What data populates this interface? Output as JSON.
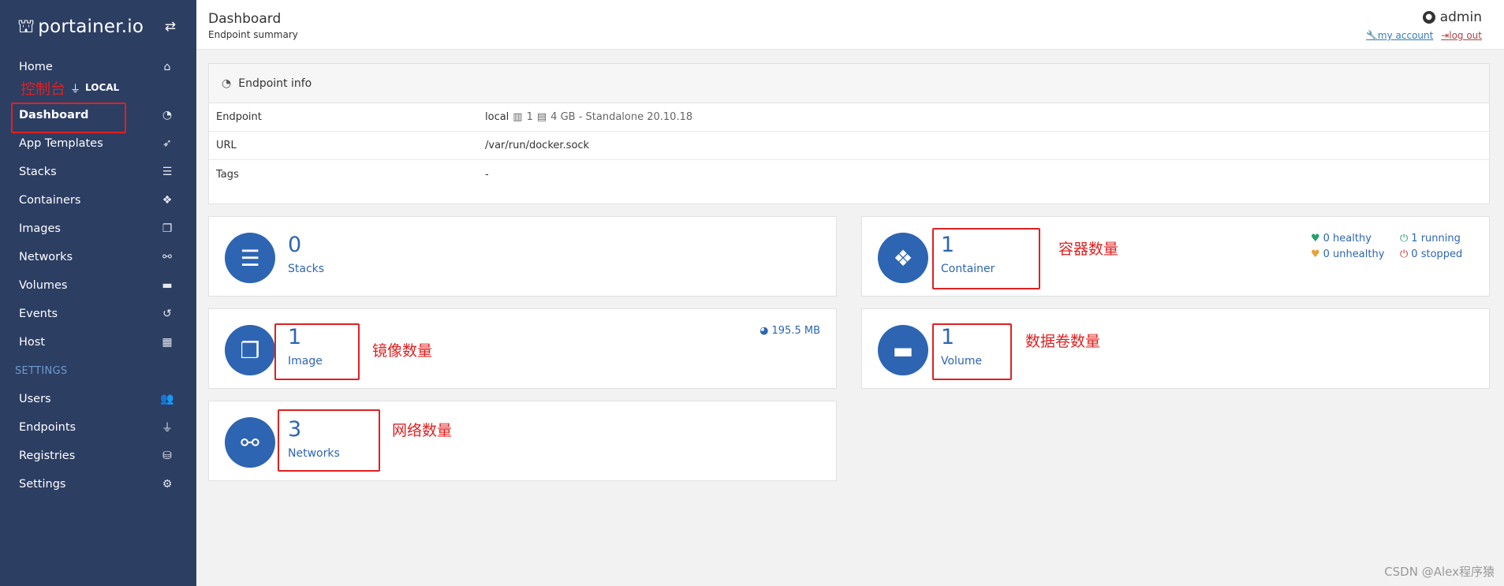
{
  "brand": {
    "name": "portainer.io"
  },
  "sidebar": {
    "home": "Home",
    "endpoint_annotation": "控制台",
    "endpoint_label": "LOCAL",
    "items": [
      {
        "label": "Dashboard",
        "icon": "tachometer-icon"
      },
      {
        "label": "App Templates",
        "icon": "rocket-icon"
      },
      {
        "label": "Stacks",
        "icon": "th-list-icon"
      },
      {
        "label": "Containers",
        "icon": "cubes-icon"
      },
      {
        "label": "Images",
        "icon": "clone-icon"
      },
      {
        "label": "Networks",
        "icon": "sitemap-icon"
      },
      {
        "label": "Volumes",
        "icon": "hdd-icon"
      },
      {
        "label": "Events",
        "icon": "history-icon"
      },
      {
        "label": "Host",
        "icon": "th-icon"
      }
    ],
    "settings_header": "SETTINGS",
    "settings_items": [
      {
        "label": "Users",
        "icon": "users-icon"
      },
      {
        "label": "Endpoints",
        "icon": "plug-icon"
      },
      {
        "label": "Registries",
        "icon": "database-icon"
      },
      {
        "label": "Settings",
        "icon": "cogs-icon"
      }
    ]
  },
  "header": {
    "title": "Dashboard",
    "subtitle": "Endpoint summary",
    "user": "admin",
    "my_account": "my account",
    "log_out": "log out"
  },
  "endpoint_info": {
    "title": "Endpoint info",
    "rows": [
      {
        "key": "Endpoint",
        "value": "local",
        "cpu": "1",
        "memory": "4 GB - Standalone 20.10.18"
      },
      {
        "key": "URL",
        "value": "/var/run/docker.sock"
      },
      {
        "key": "Tags",
        "value": "-"
      }
    ]
  },
  "widgets": {
    "stacks": {
      "count": "0",
      "label": "Stacks"
    },
    "containers": {
      "count": "1",
      "label": "Container",
      "annotation": "容器数量",
      "healthy": "0 healthy",
      "unhealthy": "0 unhealthy",
      "running": "1 running",
      "stopped": "0 stopped"
    },
    "images": {
      "count": "1",
      "label": "Image",
      "annotation": "镜像数量",
      "size": "195.5 MB"
    },
    "volumes": {
      "count": "1",
      "label": "Volume",
      "annotation": "数据卷数量"
    },
    "networks": {
      "count": "3",
      "label": "Networks",
      "annotation": "网络数量"
    }
  },
  "watermark": "CSDN @Alex程序猿",
  "colors": {
    "sidebar": "#2d3e63",
    "accent": "#2d65b2",
    "annotation": "#e02020"
  }
}
